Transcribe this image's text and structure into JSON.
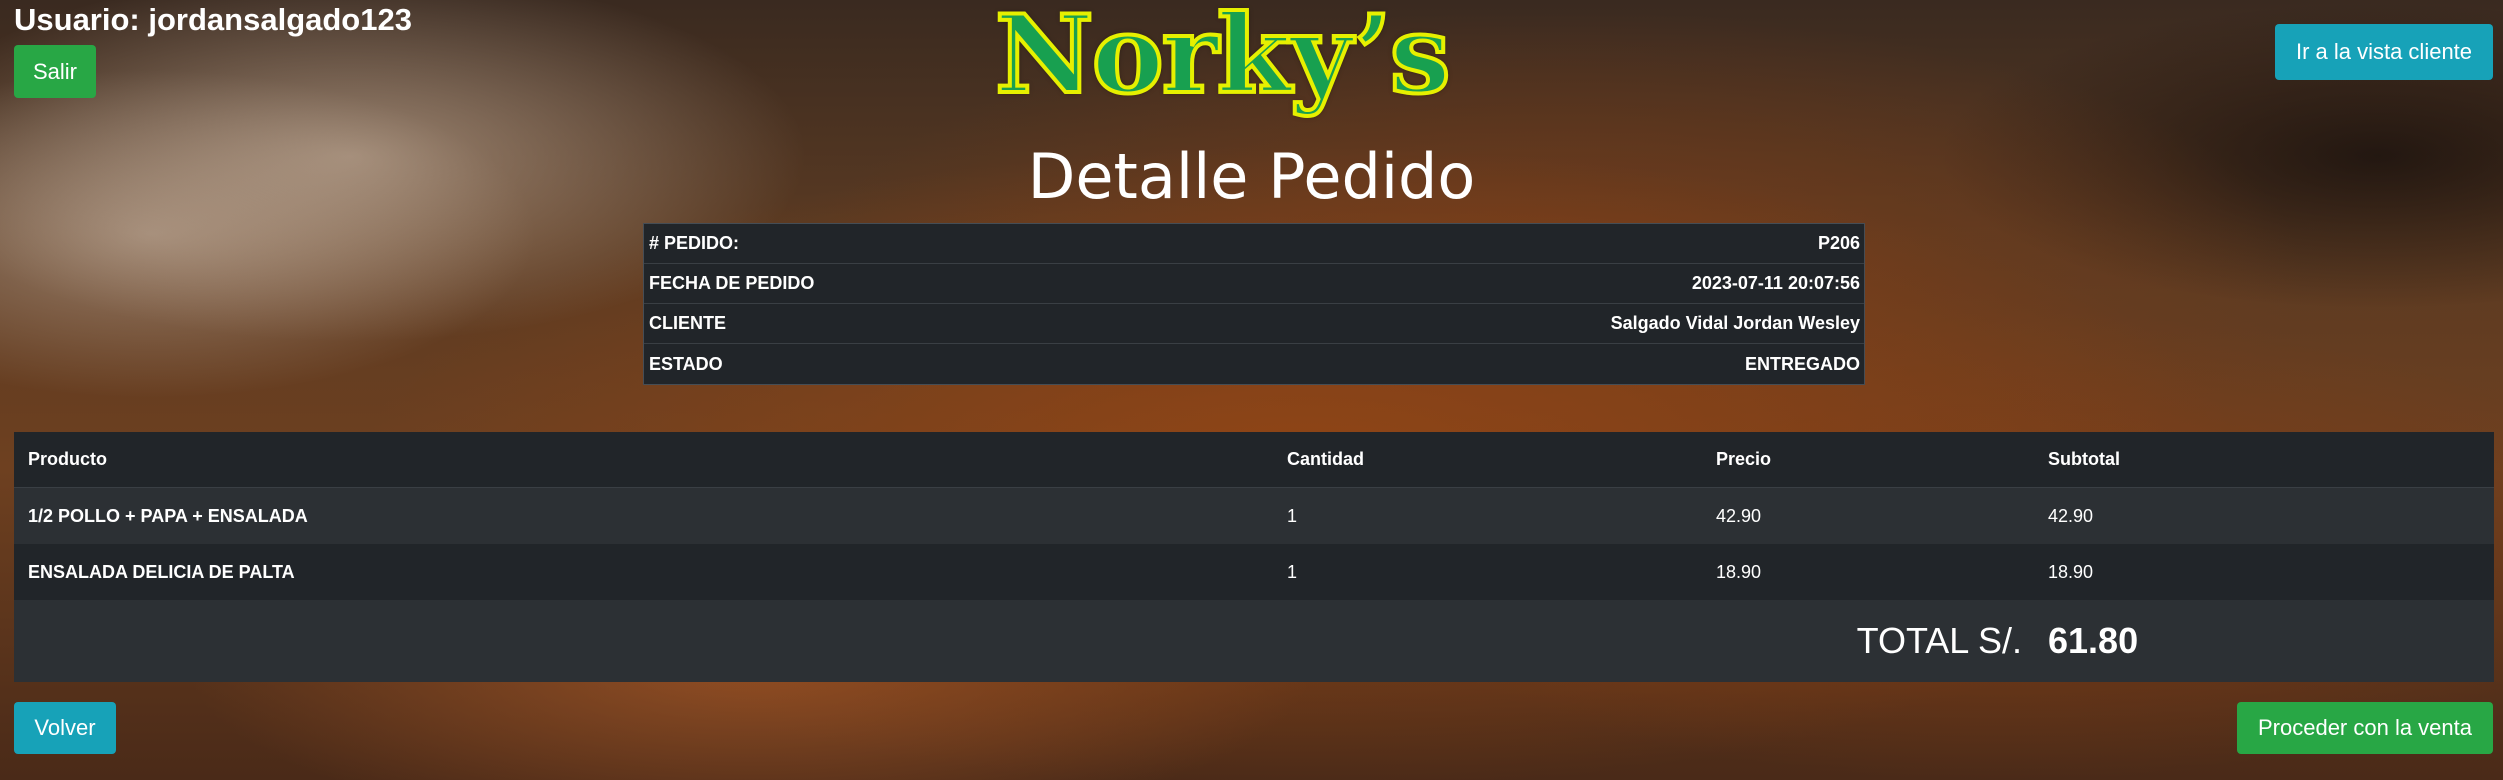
{
  "header": {
    "user_prefix": "Usuario:",
    "username": "jordansalgado123",
    "logout_label": "Salir",
    "client_view_label": "Ir a la vista cliente",
    "logo_text": "Norky’s"
  },
  "page": {
    "title": "Detalle Pedido"
  },
  "order_info": {
    "rows": [
      {
        "label": "# PEDIDO:",
        "value": "P206"
      },
      {
        "label": "FECHA DE PEDIDO",
        "value": "2023-07-11 20:07:56"
      },
      {
        "label": "CLIENTE",
        "value": "Salgado Vidal Jordan Wesley"
      },
      {
        "label": "ESTADO",
        "value": "ENTREGADO"
      }
    ]
  },
  "products": {
    "headers": {
      "product": "Producto",
      "quantity": "Cantidad",
      "price": "Precio",
      "subtotal": "Subtotal"
    },
    "rows": [
      {
        "product": "1/2 POLLO + PAPA + ENSALADA",
        "quantity": "1",
        "price": "42.90",
        "subtotal": "42.90"
      },
      {
        "product": "ENSALADA DELICIA DE PALTA",
        "quantity": "1",
        "price": "18.90",
        "subtotal": "18.90"
      }
    ],
    "total_label": "TOTAL S/.",
    "total_value": "61.80"
  },
  "footer": {
    "back_label": "Volver",
    "proceed_label": "Proceder con la venta"
  },
  "colors": {
    "green": "#28a745",
    "teal": "#17a2b8",
    "table_dark": "#212529",
    "logo_green": "#18a050",
    "logo_outline": "#e6f000"
  }
}
